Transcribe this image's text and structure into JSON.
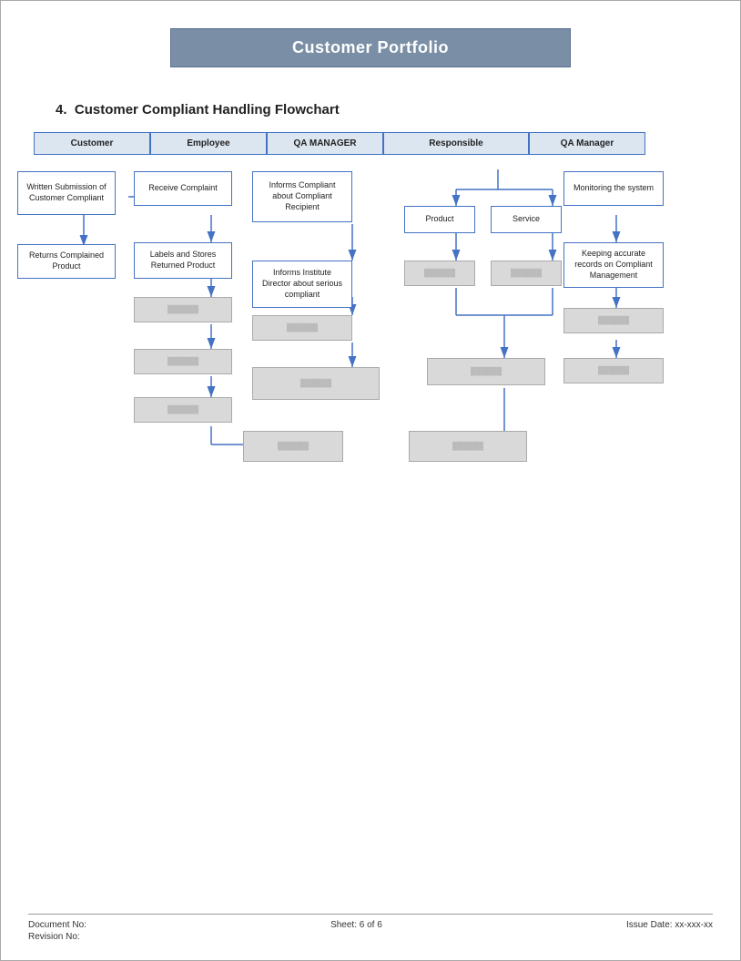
{
  "header": {
    "title": "Customer Portfolio"
  },
  "section": {
    "number": "4.",
    "title": "Customer Compliant Handling Flowchart"
  },
  "swimlanes": [
    {
      "id": "customer",
      "label": "Customer"
    },
    {
      "id": "employee",
      "label": "Employee"
    },
    {
      "id": "qa_manager",
      "label": "QA MANAGER"
    },
    {
      "id": "responsible",
      "label": "Responsible"
    },
    {
      "id": "qa_manager2",
      "label": "QA Manager"
    }
  ],
  "boxes": {
    "written_submission": "Written Submission of Customer Compliant",
    "returns_complained": "Returns Complained Product",
    "receive_complaint": "Receive Complaint",
    "labels_stores": "Labels and Stores Returned Product",
    "informs_compliant": "Informs Compliant about Compliant Recipient",
    "informs_institute": "Informs Institute Director about serious compliant",
    "product": "Product",
    "service": "Service",
    "monitoring": "Monitoring the system",
    "keeping_accurate": "Keeping accurate records on Compliant Management"
  },
  "footer": {
    "document_no_label": "Document No:",
    "revision_no_label": "Revision No:",
    "sheet_label": "Sheet: 6 of 6",
    "issue_date_label": "Issue Date: xx-xxx-xx"
  }
}
